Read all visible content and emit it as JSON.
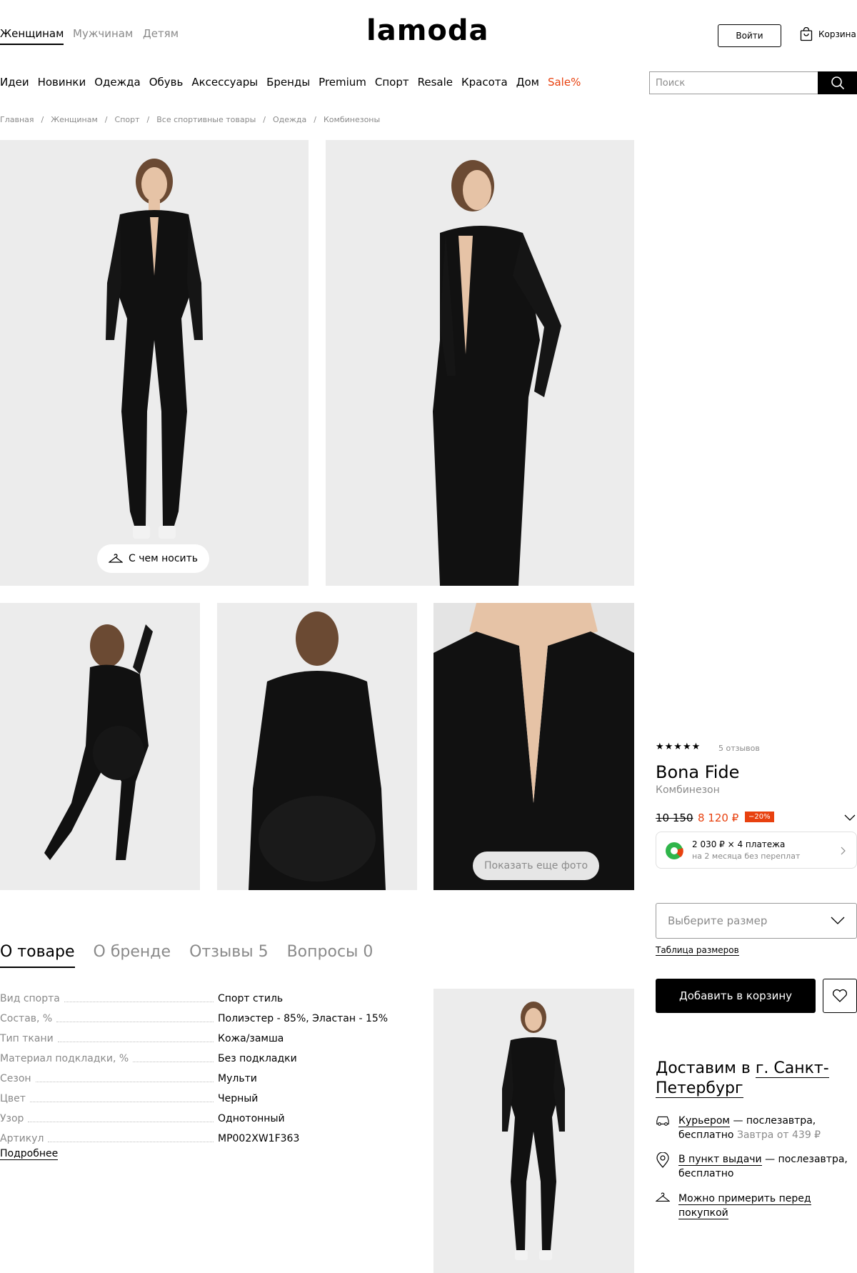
{
  "header": {
    "genders": [
      "Женщинам",
      "Мужчинам",
      "Детям"
    ],
    "logo": "lamoda",
    "login": "Войти",
    "cart": "Корзина"
  },
  "nav": {
    "items": [
      "Идеи",
      "Новинки",
      "Одежда",
      "Обувь",
      "Аксессуары",
      "Бренды",
      "Premium",
      "Спорт",
      "Resale",
      "Красота",
      "Дом"
    ],
    "sale": "Sale%"
  },
  "search": {
    "placeholder": "Поиск"
  },
  "breadcrumb": [
    "Главная",
    "Женщинам",
    "Спорт",
    "Все спортивные товары",
    "Одежда",
    "Комбинезоны"
  ],
  "gallery": {
    "wear_with": "С чем носить",
    "show_more": "Показать еще фото"
  },
  "tabs": [
    "О товаре",
    "О бренде",
    "Отзывы 5",
    "Вопросы 0"
  ],
  "specs": [
    {
      "k": "Вид спорта",
      "v": "Спорт стиль"
    },
    {
      "k": "Состав, %",
      "v": "Полиэстер - 85%, Эластан - 15%"
    },
    {
      "k": "Тип ткани",
      "v": "Кожа/замша"
    },
    {
      "k": "Материал подкладки, %",
      "v": "Без подкладки"
    },
    {
      "k": "Сезон",
      "v": "Мульти"
    },
    {
      "k": "Цвет",
      "v": "Черный"
    },
    {
      "k": "Узор",
      "v": "Однотонный"
    },
    {
      "k": "Артикул",
      "v": "MP002XW1F363"
    }
  ],
  "more": "Подробнее",
  "product": {
    "stars": "★★★★★",
    "rating": 4.5,
    "reviews": "5 отзывов",
    "brand": "Bona Fide",
    "type": "Комбинезон",
    "price_old": "10 150",
    "price_new": "8 120 ₽",
    "discount": "−20%",
    "installment_main": "2 030 ₽ × 4 платежа",
    "installment_sub": "на 2 месяца без переплат",
    "size_placeholder": "Выберите размер",
    "size_table": "Таблица размеров",
    "add_to_cart": "Добавить в корзину"
  },
  "delivery": {
    "title_prefix": "Доставим в",
    "city": "г. Санкт-Петербург",
    "courier_link": "Курьером",
    "courier_text": " — послезавтра, бесплатно",
    "courier_extra": " Завтра от 439 ₽",
    "pickup_link": "В пункт выдачи",
    "pickup_text": " — послезавтра, бесплатно",
    "fitting": "Можно примерить перед покупкой"
  },
  "colors": {
    "accent": "#e8410f",
    "photo_bg": "#ececec",
    "suit": "#111111"
  }
}
